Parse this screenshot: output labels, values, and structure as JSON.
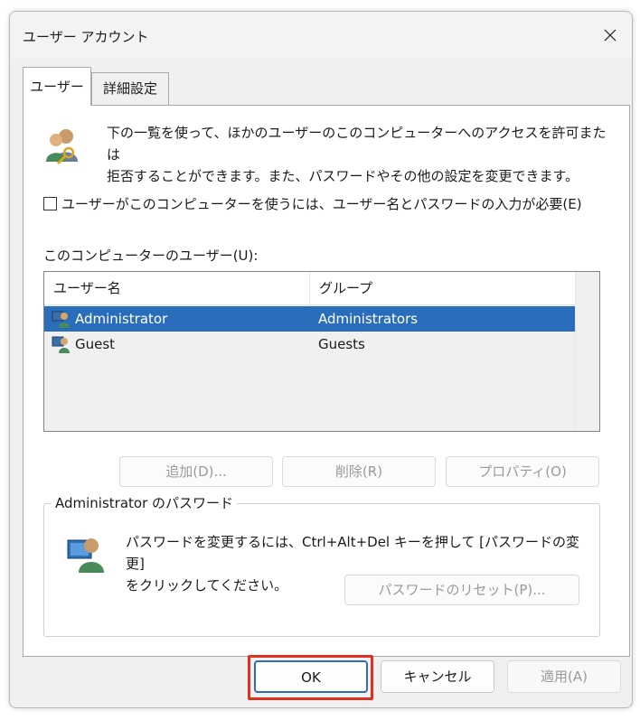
{
  "window": {
    "title": "ユーザー アカウント"
  },
  "tabs": [
    {
      "label": "ユーザー",
      "active": true
    },
    {
      "label": "詳細設定",
      "active": false
    }
  ],
  "intro": {
    "text_line1": "下の一覧を使って、ほかのユーザーのこのコンピューターへのアクセスを許可または",
    "text_line2": "拒否することができます。また、パスワードやその他の設定を変更できます。"
  },
  "require_login": {
    "label": "ユーザーがこのコンピューターを使うには、ユーザー名とパスワードの入力が必要(E)",
    "checked": false
  },
  "users_list": {
    "label": "このコンピューターのユーザー(U):",
    "columns": [
      "ユーザー名",
      "グループ"
    ],
    "rows": [
      {
        "name": "Administrator",
        "group": "Administrators",
        "selected": true
      },
      {
        "name": "Guest",
        "group": "Guests",
        "selected": false
      }
    ]
  },
  "list_buttons": {
    "add": "追加(D)...",
    "remove": "削除(R)",
    "properties": "プロパティ(O)"
  },
  "password_group": {
    "legend": "Administrator のパスワード",
    "text_line1": "パスワードを変更するには、Ctrl+Alt+Del キーを押して [パスワードの変更]",
    "text_line2": "をクリックしてください。",
    "reset_button": "パスワードのリセット(P)..."
  },
  "footer": {
    "ok": "OK",
    "cancel": "キャンセル",
    "apply": "適用(A)"
  },
  "colors": {
    "selection": "#2a6ebb",
    "highlight_border": "#e03020",
    "ok_button_border": "#2f6cb5"
  }
}
